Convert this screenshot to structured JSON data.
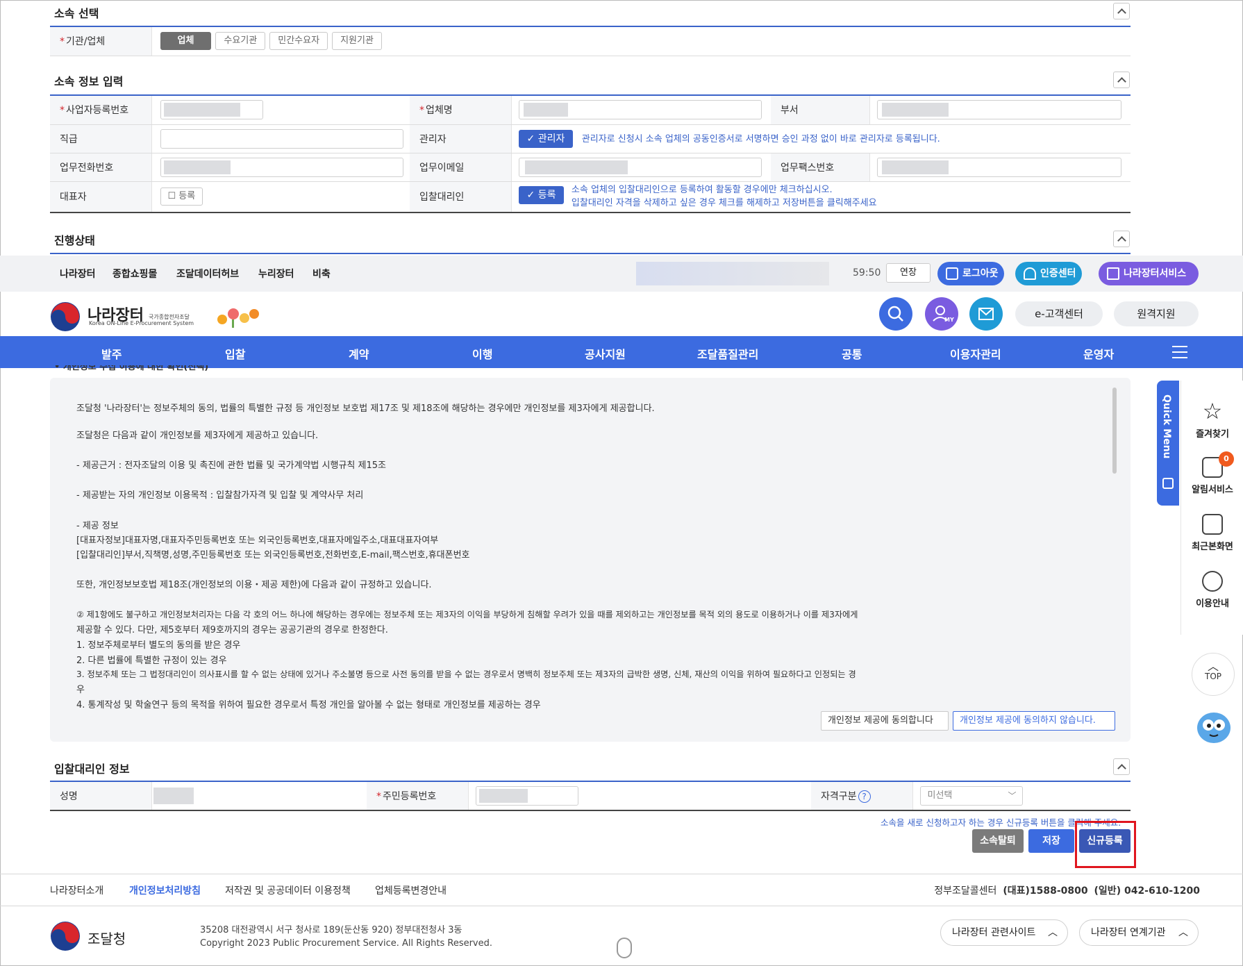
{
  "affiliation_select": {
    "title": "소속 선택",
    "label": "기관/업체",
    "options": [
      "업체",
      "수요기관",
      "민간수요자",
      "지원기관"
    ],
    "selected": "업체"
  },
  "affiliation_info": {
    "title": "소속 정보 입력",
    "biz_no_label": "사업자등록번호",
    "company_label": "업체명",
    "dept_label": "부서",
    "position_label": "직급",
    "manager_label": "관리자",
    "manager_check": "관리자",
    "manager_note": "관리자로 신청시 소속 업체의 공동인증서로 서명하면 승인 과정 없이 바로 관리자로 등록됩니다.",
    "phone_label": "업무전화번호",
    "email_label": "업무이메일",
    "fax_label": "업무팩스번호",
    "rep_label": "대표자",
    "rep_check": "등록",
    "agent_label": "입찰대리인",
    "agent_check": "등록",
    "agent_note1": "소속 업체의 입찰대리인으로 등록하여 활동할 경우에만 체크하십시오.",
    "agent_note2": "입찰대리인 자격을 삭제하고 싶은 경우 체크를 해제하고 저장버튼을 클릭해주세요"
  },
  "progress": {
    "title": "진행상태"
  },
  "utilbar": {
    "links": [
      "나라장터",
      "종합쇼핑몰",
      "조달데이터허브",
      "누리장터",
      "비축"
    ],
    "timer": "59:50",
    "extend": "연장",
    "logout": "로그아웃",
    "cert_center": "인증센터",
    "services": "나라장터서비스"
  },
  "header": {
    "logo_main": "나라장터",
    "logo_sub_kr": "국가종합전자조달",
    "logo_sub_en": "Korea ON-Line E-Procurement System",
    "customer_center": "e-고객센터",
    "remote_support": "원격지원",
    "my_label": "MY"
  },
  "nav": {
    "items": [
      "발주",
      "입찰",
      "계약",
      "이행",
      "공사지원",
      "조달품질관리",
      "공통",
      "이용자관리",
      "운영자"
    ]
  },
  "agreement": {
    "cut_heading": "• 개인정보 수집 이용에 대한 확인(선택)",
    "lines": [
      "조달청 '나라장터'는 정보주체의 동의, 법률의 특별한 규정 등 개인정보 보호법 제17조 및 제18조에 해당하는 경우에만 개인정보를 제3자에게 제공합니다.",
      "조달청은 다음과 같이 개인정보를 제3자에게 제공하고 있습니다.",
      "- 제공근거 : 전자조달의 이용 및 촉진에 관한 법률 및 국가계약법 시행규칙 제15조",
      "- 제공받는 자의 개인정보 이용목적 : 입찰참가자격 및 입찰 및 계약사무 처리",
      "- 제공 정보",
      "[대표자정보]대표자명,대표자주민등록번호 또는 외국인등록번호,대표자메일주소,대표대표자여부",
      "[입찰대리인]부서,직책명,성명,주민등록번호 또는 외국인등록번호,전화번호,E-mail,팩스번호,휴대폰번호",
      "또한, 개인정보보호법 제18조(개인정보의 이용・제공 제한)에 다음과 같이 규정하고 있습니다.",
      "② 제1항에도 불구하고 개인정보처리자는 다음 각 호의 어느 하나에 해당하는 경우에는 정보주체 또는 제3자의 이익을 부당하게 침해할 우려가 있을 때를 제외하고는 개인정보를 목적 외의 용도로 이용하거나 이를 제3자에게",
      "제공할 수 있다. 다만, 제5호부터 제9호까지의 경우는 공공기관의 경우로 한정한다.",
      "1. 정보주체로부터 별도의 동의를 받은 경우",
      "2. 다른 법률에 특별한 규정이 있는 경우",
      "3. 정보주체 또는 그 법정대리인이 의사표시를 할 수 없는 상태에 있거나 주소불명 등으로 사전 동의를 받을 수 없는 경우로서 명백히 정보주체 또는 제3자의 급박한 생명, 신체, 재산의 이익을 위하여 필요하다고 인정되는 경",
      "우",
      "4. 통계작성 및 학술연구 등의 목적을 위하여 필요한 경우로서 특정 개인을 알아볼 수 없는 형태로 개인정보를 제공하는 경우"
    ],
    "agree_btn": "개인정보 제공에 동의합니다",
    "disagree_btn": "개인정보 제공에 동의하지 않습니다."
  },
  "quick_menu": {
    "tab": "Quick Menu",
    "items": [
      "즐겨찾기",
      "알림서비스",
      "최근본화면",
      "이용안내"
    ],
    "badge": "0",
    "top": "TOP"
  },
  "agent_info": {
    "title": "입찰대리인 정보",
    "name_label": "성명",
    "rrn_label": "주민등록번호",
    "qual_label": "자격구분",
    "qual_value": "미선택",
    "help": "?"
  },
  "actions": {
    "hint": "소속을 새로 신청하고자 하는 경우 신규등록 버튼을 클릭해 주세요.",
    "withdraw": "소속탈퇴",
    "save": "저장",
    "new_register": "신규등록"
  },
  "footer": {
    "links": [
      "나라장터소개",
      "개인정보처리방침",
      "저작권 및 공공데이터 이용정책",
      "업체등록변경안내"
    ],
    "call_center": "정부조달콜센터",
    "rep_phone": "(대표)1588-0800",
    "general_phone": "(일반) 042-610-1200",
    "org_name": "조달청",
    "address": "35208 대전광역시 서구 청사로 189(둔산동 920) 정부대전청사 3동",
    "copyright": "Copyright 2023 Public Procurement Service. All Rights Reserved.",
    "related_sites": "나라장터 관련사이트",
    "linked_orgs": "나라장터 연계기관"
  },
  "colors": {
    "primary": "#3c6be0",
    "section_line": "#3a63c9",
    "required": "#d3272d",
    "purple": "#7a5ce0",
    "highlight": "#e0161f"
  }
}
